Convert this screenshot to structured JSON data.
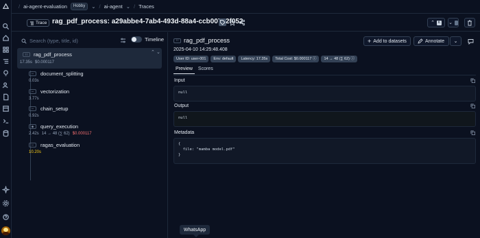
{
  "topbar": {
    "project": "ai-agent-evaluation",
    "plan_badge": "Hobby",
    "environment": "ai-agent",
    "section": "Traces"
  },
  "header": {
    "trace_badge": "Trace",
    "trace_title": "rag_pdf_process: a29abbe4-7ab4-493d-88a4-ccb007a2f052"
  },
  "left_panel": {
    "search_placeholder": "Search (type, title, id)",
    "timeline_label": "Timeline",
    "root": {
      "name": "rag_pdf_process",
      "icon_text": "⁝⁝",
      "duration": "17.35s",
      "cost": "$0.000117"
    },
    "children": [
      {
        "name": "document_splitting",
        "icon": "span",
        "duration": "0.03s"
      },
      {
        "name": "vectorization",
        "icon": "span",
        "duration": "3.77s"
      },
      {
        "name": "chain_setup",
        "icon": "span",
        "duration": "0.92s"
      },
      {
        "name": "query_execution",
        "icon": "generation",
        "duration": "2.42s",
        "tokens": "14 → 48 (∑ 62)",
        "cost": "$0.000117"
      },
      {
        "name": "ragas_evaluation",
        "icon": "span",
        "duration": "10.20s",
        "duration_color": "#facc15"
      }
    ]
  },
  "right_panel": {
    "title": "rag_pdf_process",
    "timestamp": "2025-04-10 14:25:48.408",
    "chips": [
      "User ID: user-001",
      "Env: default",
      "Latency: 17.35s",
      "Total Cost: $0.000117 ⓘ",
      "14 → 48 (∑ 62) ⓘ"
    ],
    "tabs": [
      "Preview",
      "Scores"
    ],
    "add_to_datasets": "Add to datasets",
    "annotate": "Annotate",
    "input_label": "Input",
    "input_value": "null",
    "output_label": "Output",
    "output_value": "null",
    "metadata_label": "Metadata",
    "metadata_lines": [
      "{",
      "  file: \"mamba model.pdf\"",
      "}"
    ]
  },
  "tooltip": "WhatsApp",
  "colors": {
    "background": "#0b1120",
    "panel": "#1e293b",
    "cost_red": "#f87171",
    "warn_yellow": "#facc15"
  }
}
